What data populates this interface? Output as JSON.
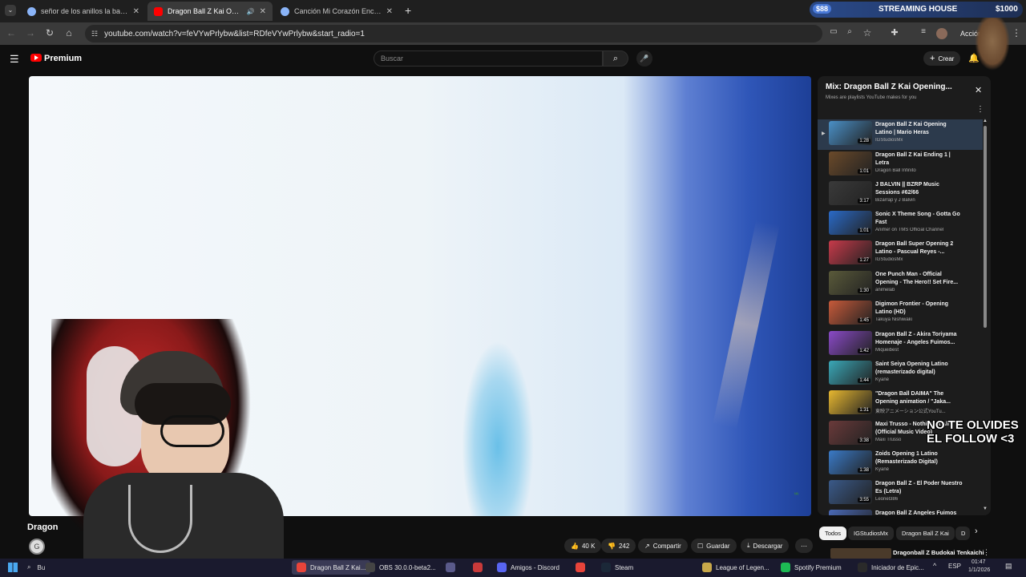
{
  "browser": {
    "tabs": [
      {
        "title": "señor de los anillos la batalla p",
        "active": false,
        "icon": "globe-icon"
      },
      {
        "title": "Dragon Ball Z Kai Opening",
        "active": true,
        "icon": "youtube-icon"
      },
      {
        "title": "Canción Mi Corazón Encantado",
        "active": false,
        "icon": "globe-icon"
      }
    ],
    "url": "youtube.com/watch?v=feVYwPrlybw&list=RDfeVYwPrlybw&start_radio=1",
    "action_label": "Acción",
    "ad": {
      "badge": "$88",
      "title": "STREAMING HOUSE",
      "amount": "$1000"
    }
  },
  "youtube": {
    "brand": "Premium",
    "search_placeholder": "Buscar",
    "create_label": "Crear"
  },
  "video": {
    "title_partial": "Dragon",
    "likes": "40 K",
    "dislikes": "242",
    "share_label": "Compartir",
    "save_label": "Guardar",
    "download_label": "Descargar"
  },
  "playlist": {
    "title": "Mix: Dragon Ball Z Kai Opening...",
    "subtitle": "Mixes are playlists YouTube makes for you",
    "items": [
      {
        "title": "Dragon Ball Z Kai Opening Latino | Mario Heras",
        "channel": "IGStudiosMx",
        "duration": "1:28",
        "color": "#4a90c8"
      },
      {
        "title": "Dragon Ball Z Kai Ending 1 | Letra",
        "channel": "Dragon Ball Infinito",
        "duration": "1:01",
        "color": "#6b4a2a"
      },
      {
        "title": "J BALVIN || BZRP Music Sessions #62/66",
        "channel": "Bizarrap y J Balvin",
        "duration": "3:17",
        "color": "#3a3a3a"
      },
      {
        "title": "Sonic X Theme Song - Gotta Go Fast",
        "channel": "Anime! on TMS Official Channel",
        "duration": "1:01",
        "color": "#2a6ac8"
      },
      {
        "title": "Dragon Ball Super Opening 2 Latino - Pascual Reyes -...",
        "channel": "IGStudiosMx",
        "duration": "1:27",
        "color": "#c83a4a"
      },
      {
        "title": "One Punch Man - Official Opening - The Hero!! Set Fire...",
        "channel": "animelab",
        "duration": "1:30",
        "color": "#5a5a3a"
      },
      {
        "title": "Digimon Frontier - Opening Latino (HD)",
        "channel": "Takuya Nishiwaki",
        "duration": "1:45",
        "color": "#c85a3a"
      },
      {
        "title": "Dragon Ball Z - Akira Toriyama Homenaje - Angeles Fuimos...",
        "channel": "Miqueibest",
        "duration": "1:42",
        "color": "#8a4ac8"
      },
      {
        "title": "Saint Seiya Opening Latino (remasterizado digital)",
        "channel": "Kyané",
        "duration": "1:44",
        "color": "#3aa8b8"
      },
      {
        "title": "\"Dragon Ball DAIMA\" The Opening animation / \"Jaka...",
        "channel": "東映アニメーション公式YouTu...",
        "duration": "1:31",
        "color": "#e8b830"
      },
      {
        "title": "Maxi Trusso - Nothing at All (Official Music Video)",
        "channel": "Maxi Trusso",
        "duration": "3:38",
        "color": "#6a3a3a"
      },
      {
        "title": "Zoids Opening 1 Latino (Remasterizado Digital)",
        "channel": "Kyané",
        "duration": "1:38",
        "color": "#3a7ac8"
      },
      {
        "title": "Dragon Ball Z - El Poder Nuestro Es (Letra)",
        "channel": "Leonel386",
        "duration": "3:55",
        "color": "#3a5a8a"
      },
      {
        "title": "Dragon Ball Z Angeles Fuimos",
        "channel": "",
        "duration": "",
        "color": "#4a6ab8"
      }
    ]
  },
  "chips": [
    "Todos",
    "IGStudiosMx",
    "Dragon Ball Z Kai",
    "D"
  ],
  "next_video_partial": "Dragonball Z Budokai Tenkaichi",
  "overlay_text": [
    "NO TE OLVIDES",
    "EL FOLLOW <3"
  ],
  "taskbar": {
    "search_partial": "Bu",
    "apps": [
      {
        "label": "Dragon Ball Z Kai...",
        "color": "#e8443a"
      },
      {
        "label": "OBS 30.0.0-beta2...",
        "color": "#444444"
      },
      {
        "label": "",
        "color": "#5a5a8a"
      },
      {
        "label": "",
        "color": "#c83a3a"
      },
      {
        "label": "Amigos - Discord",
        "color": "#5865f2"
      },
      {
        "label": "",
        "color": "#e8443a"
      },
      {
        "label": "Steam",
        "color": "#1b2838"
      },
      {
        "label": "League of Legen...",
        "color": "#c8a84a"
      },
      {
        "label": "Spotify Premium",
        "color": "#1db954"
      },
      {
        "label": "Iniciador de Epic...",
        "color": "#2a2a2a"
      }
    ],
    "lang": "ESP",
    "time": "01:47",
    "date": "1/1/2026"
  }
}
